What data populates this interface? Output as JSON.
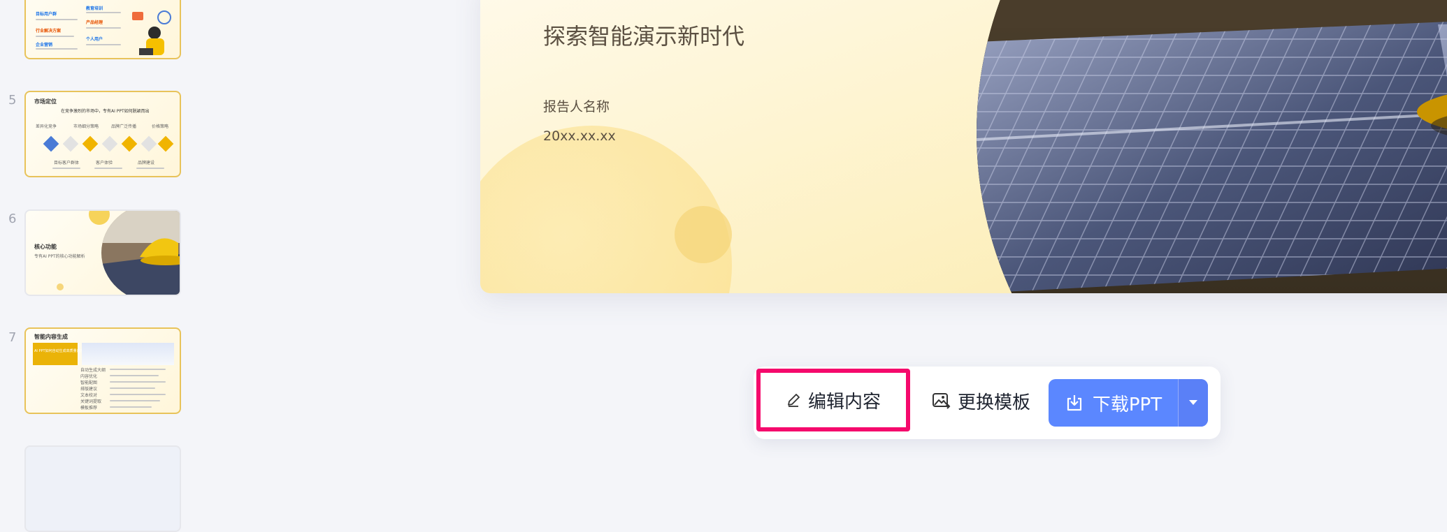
{
  "sidebar": {
    "slides": [
      {
        "number": "",
        "items": [
          "目标用户群",
          "行业解决方案",
          "企业营销",
          "教育培训",
          "产品经理",
          "个人用户"
        ]
      },
      {
        "number": "5",
        "title": "市场定位",
        "subtitle": "在竞争激烈的市场中，专有AI PPT如何脱颖而出",
        "labels_top": [
          "差异化竞争",
          "市场细分策略",
          "品牌广泛传播",
          "价格策略"
        ],
        "labels_bottom": [
          "目标客户群体",
          "客户体验",
          "品牌建设"
        ]
      },
      {
        "number": "6",
        "title": "核心功能",
        "subtitle": "专有AI PPT的核心功能解析"
      },
      {
        "number": "7",
        "title": "智能内容生成",
        "highlight": "AI PPT如何自动生成高质量内容",
        "rows": [
          "自动生成大纲",
          "内容优化",
          "智能配图",
          "排版建议",
          "文本校对",
          "关键词提取",
          "模板推荐"
        ]
      }
    ]
  },
  "slide": {
    "subtitle": "探索智能演示新时代",
    "reporter": "报告人名称",
    "date": "20xx.xx.xx"
  },
  "toolbar": {
    "edit_label": "编辑内容",
    "template_label": "更换模板",
    "download_label": "下载PPT"
  },
  "colors": {
    "accent": "#5b87ff",
    "highlight_border": "#f5096c",
    "thumb_border": "#e8c35a"
  },
  "icons": {
    "edit": "pencil-icon",
    "template": "image-swap-icon",
    "download": "download-icon",
    "dropdown": "caret-down-icon"
  }
}
